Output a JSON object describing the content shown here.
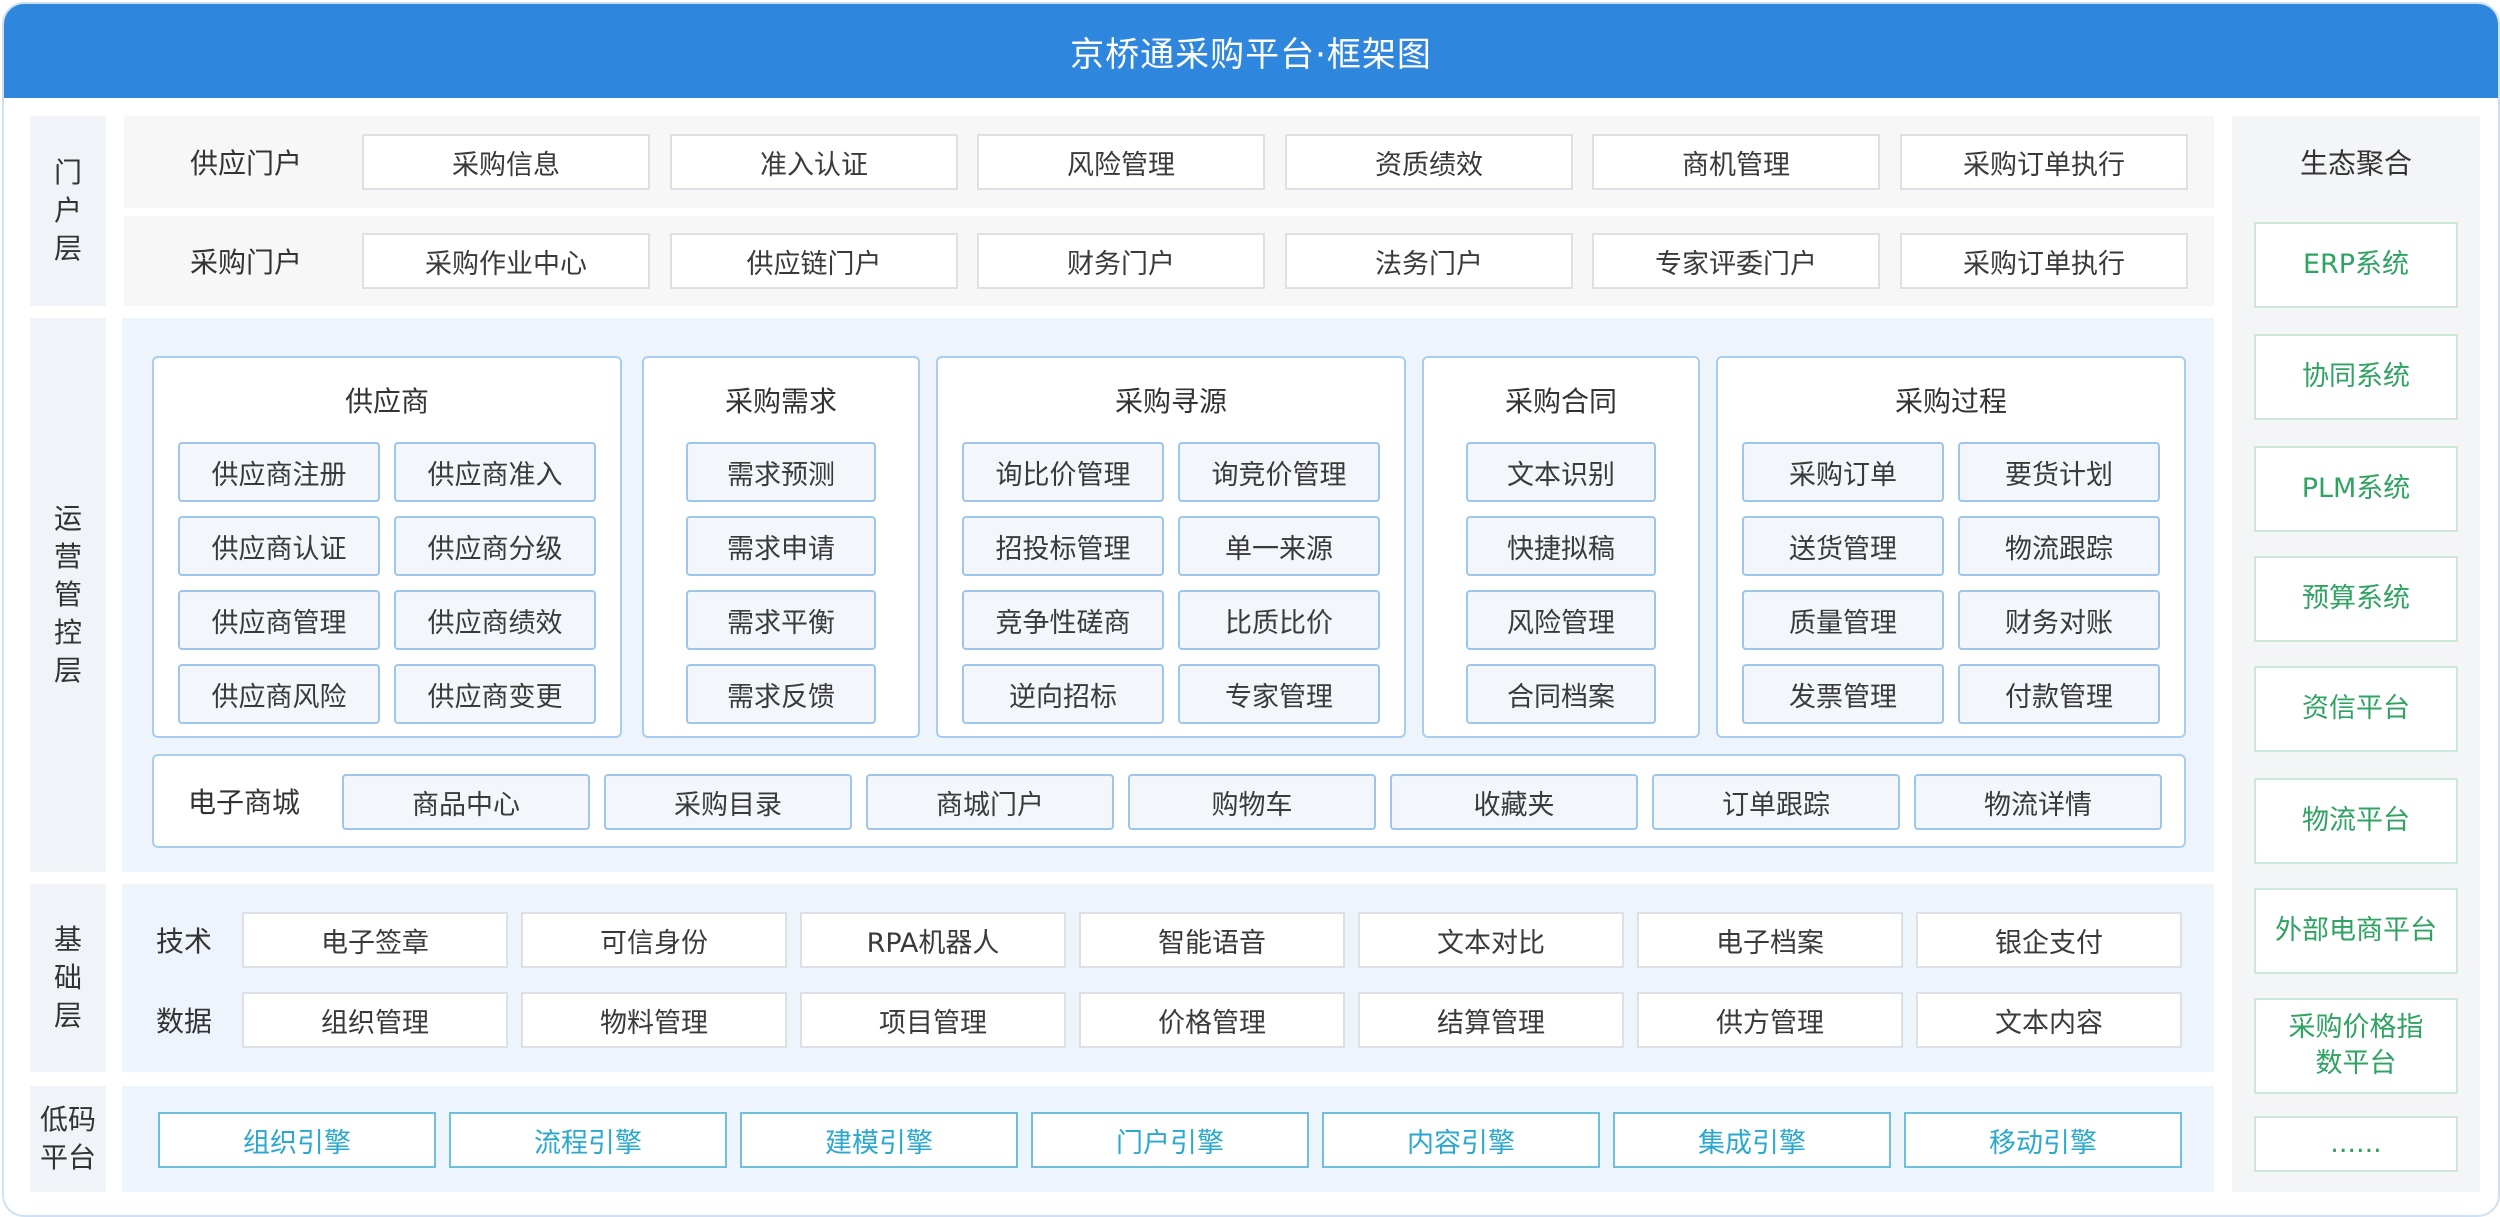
{
  "title": "京桥通采购平台·框架图",
  "layers": {
    "portal": [
      "门",
      "户",
      "层"
    ],
    "ops": [
      "运",
      "营",
      "管",
      "控",
      "层"
    ],
    "base": [
      "基",
      "础",
      "层"
    ],
    "lowcode": [
      "低码",
      "平台"
    ]
  },
  "portal": {
    "rows": [
      {
        "title": "供应门户",
        "items": [
          "采购信息",
          "准入认证",
          "风险管理",
          "资质绩效",
          "商机管理",
          "采购订单执行"
        ]
      },
      {
        "title": "采购门户",
        "items": [
          "采购作业中心",
          "供应链门户",
          "财务门户",
          "法务门户",
          "专家评委门户",
          "采购订单执行"
        ]
      }
    ]
  },
  "ops": {
    "groups": [
      {
        "title": "供应商",
        "items": [
          "供应商注册",
          "供应商准入",
          "供应商认证",
          "供应商分级",
          "供应商管理",
          "供应商绩效",
          "供应商风险",
          "供应商变更"
        ]
      },
      {
        "title": "采购需求",
        "items": [
          "需求预测",
          "需求申请",
          "需求平衡",
          "需求反馈"
        ]
      },
      {
        "title": "采购寻源",
        "items": [
          "询比价管理",
          "询竞价管理",
          "招投标管理",
          "单一来源",
          "竞争性磋商",
          "比质比价",
          "逆向招标",
          "专家管理"
        ]
      },
      {
        "title": "采购合同",
        "items": [
          "文本识别",
          "快捷拟稿",
          "风险管理",
          "合同档案"
        ]
      },
      {
        "title": "采购过程",
        "items": [
          "采购订单",
          "要货计划",
          "送货管理",
          "物流跟踪",
          "质量管理",
          "财务对账",
          "发票管理",
          "付款管理"
        ]
      }
    ],
    "mall": {
      "title": "电子商城",
      "items": [
        "商品中心",
        "采购目录",
        "商城门户",
        "购物车",
        "收藏夹",
        "订单跟踪",
        "物流详情"
      ]
    }
  },
  "base": {
    "rows": [
      {
        "title": "技术",
        "items": [
          "电子签章",
          "可信身份",
          "RPA机器人",
          "智能语音",
          "文本对比",
          "电子档案",
          "银企支付"
        ]
      },
      {
        "title": "数据",
        "items": [
          "组织管理",
          "物料管理",
          "项目管理",
          "价格管理",
          "结算管理",
          "供方管理",
          "文本内容"
        ]
      }
    ]
  },
  "lowcode": {
    "items": [
      "组织引擎",
      "流程引擎",
      "建模引擎",
      "门户引擎",
      "内容引擎",
      "集成引擎",
      "移动引擎"
    ]
  },
  "eco": {
    "title": "生态聚合",
    "items": [
      "ERP系统",
      "协同系统",
      "PLM系统",
      "预算系统",
      "资信平台",
      "物流平台",
      "外部电商平台",
      "采购价格指数平台",
      "......"
    ]
  },
  "colors": {
    "header": "#2f86dd",
    "accent_border": "#9ec6ea",
    "lowcode_text": "#2aa8cf",
    "eco_text": "#2fa362"
  }
}
